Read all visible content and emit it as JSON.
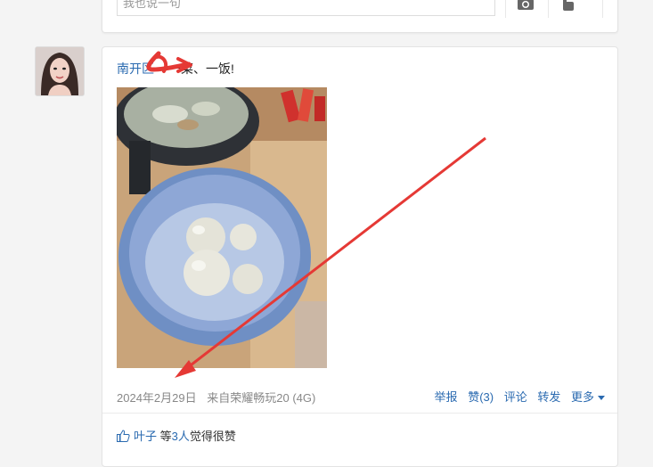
{
  "prev_post": {
    "comment_placeholder": "我也说一句"
  },
  "post": {
    "author": "南开区",
    "text_suffix": "一菜、一饭!",
    "date": "2024年2月29日",
    "source": "来自荣耀畅玩20 (4G)",
    "actions": {
      "report": "举报",
      "like": "赞(3)",
      "comment": "评论",
      "share": "转发",
      "more": "更多"
    },
    "likes": {
      "first_liker": "叶子",
      "middle": "等",
      "count": "3人",
      "suffix": "觉得很赞"
    }
  },
  "colors": {
    "link": "#2a6ab0",
    "annotation": "#e53935",
    "bowl": "#7f9ccc"
  }
}
